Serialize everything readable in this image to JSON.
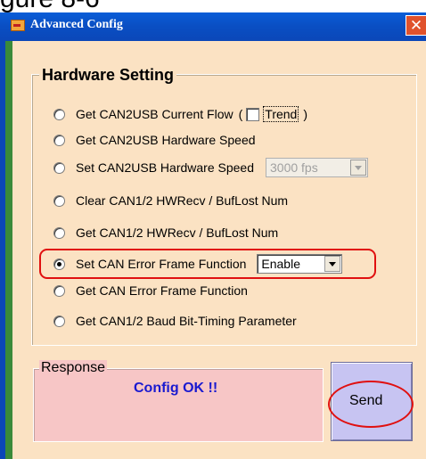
{
  "window": {
    "cut_off_top_text": "gure 8-6",
    "title": "Advanced Config",
    "close_glyph": "✕"
  },
  "hardware_setting": {
    "title": "Hardware Setting",
    "options": [
      {
        "label": "Get CAN2USB Current Flow",
        "paren_open": "(",
        "checkbox_label": "Trend",
        "paren_close": ")",
        "checked": false,
        "selected": false
      },
      {
        "label": "Get CAN2USB Hardware Speed",
        "selected": false
      },
      {
        "label": "Set CAN2USB Hardware Speed",
        "combo_value": "3000 fps",
        "combo_enabled": false,
        "selected": false
      },
      {
        "label": "Clear CAN1/2 HWRecv / BufLost Num",
        "selected": false
      },
      {
        "label": "Get CAN1/2 HWRecv / BufLost Num",
        "selected": false
      },
      {
        "label": "Set CAN Error Frame Function",
        "combo_value": "Enable",
        "combo_enabled": true,
        "selected": true
      },
      {
        "label": "Get CAN Error Frame Function",
        "selected": false
      },
      {
        "label": "Get CAN1/2 Baud Bit-Timing Parameter",
        "selected": false
      }
    ]
  },
  "response": {
    "title": "Response",
    "message": "Config OK !!"
  },
  "send_button": {
    "label": "Send"
  },
  "colors": {
    "titlebar": "#0a5ed8",
    "client_background": "#fbe2c3",
    "response_background": "#f7c6c6",
    "send_button": "#c7c4f2",
    "response_text": "#1a1ad0",
    "annotation_red": "#e01010"
  }
}
